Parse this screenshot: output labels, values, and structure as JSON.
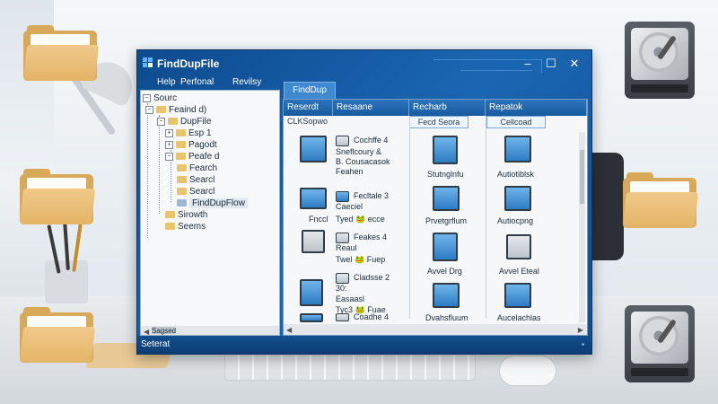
{
  "window": {
    "title": "FindDupFile"
  },
  "menu": [
    "Help",
    "Perfonal",
    "Revilsy"
  ],
  "tree": {
    "items": [
      "Sourc",
      "Feaind d)",
      "DupFile",
      "Esp 1",
      "Pagodt",
      "Peafe d",
      "Fearch",
      "Searcl",
      "FindDupFlow",
      "Sirowth",
      "Seems"
    ],
    "scrollbar_label": "Sagsed"
  },
  "content": {
    "tab": "FindDup",
    "columns": [
      "Reserdt",
      "Resaane",
      "Recharb",
      "Repatok"
    ],
    "sub_headers": [
      "CLKSopwo",
      "Fecd Seora",
      "Cellcoad"
    ],
    "col1": [
      {
        "label": "Fnccl"
      },
      {
        "label": "Tyed 🐸 ecce"
      },
      {
        "label": "Twel 🐸 Fuep"
      },
      {
        "label": "Tyc3 🐸 Fuae"
      },
      {
        "label": ""
      }
    ],
    "col2": [
      {
        "lines": [
          "Cochffe 4",
          "Sneflcoury &",
          "B. Cousacasok",
          "Feahen"
        ]
      },
      {
        "lines": [
          "Fecltale 3",
          "Caeciel"
        ]
      },
      {
        "lines": [
          "Feakes 4",
          "Reaul"
        ]
      },
      {
        "lines": [
          "Cladsse 2",
          "30:",
          "Easaasl"
        ]
      },
      {
        "lines": [
          "Coadhe 4"
        ]
      }
    ],
    "col3": [
      {
        "label": "Stutnglnfu"
      },
      {
        "label": "Prvetgrflum"
      },
      {
        "label": "Avvel Drg"
      },
      {
        "label": "Dvahsfluum"
      }
    ],
    "col4": [
      {
        "label": "Autiotiblsk"
      },
      {
        "label": "Autiocpng"
      },
      {
        "label": "Avvel Eteal"
      },
      {
        "label": "Aucelachlas"
      }
    ]
  },
  "status": {
    "text": "Seterat"
  },
  "colors": {
    "window_frame": "#1b66b3",
    "header_blue": "#2d74bd",
    "folder": "#e4b466",
    "pane_bg": "#f5f7f9"
  },
  "icons": {
    "floating_left": "folder-icon",
    "floating_right": "hard-drive-icon",
    "file_thumbnail": "image-file-icon"
  }
}
